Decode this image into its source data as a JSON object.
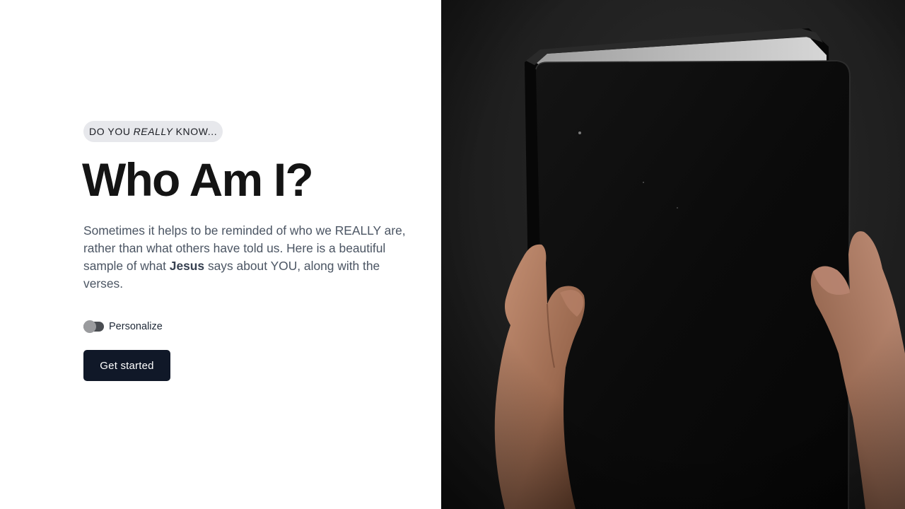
{
  "hero": {
    "eyebrow_prefix": "DO YOU",
    "eyebrow_emphasis": "REALLY",
    "eyebrow_suffix": "KNOW...",
    "title": "Who Am I?",
    "lead_part1": "Sometimes it helps to be reminded of who we REALLY are, rather than what others have told us. Here is a beautiful sample of what ",
    "lead_bold": "Jesus",
    "lead_part2": " says about YOU, along with the verses.",
    "toggle_label": "Personalize",
    "toggle_on": false,
    "cta_label": "Get started"
  },
  "colors": {
    "cta_bg": "#101828",
    "title": "#141414",
    "body_text": "#4b5563",
    "eyebrow_bg": "#e7e8ec",
    "photo_bg": "#1f1f1f"
  }
}
